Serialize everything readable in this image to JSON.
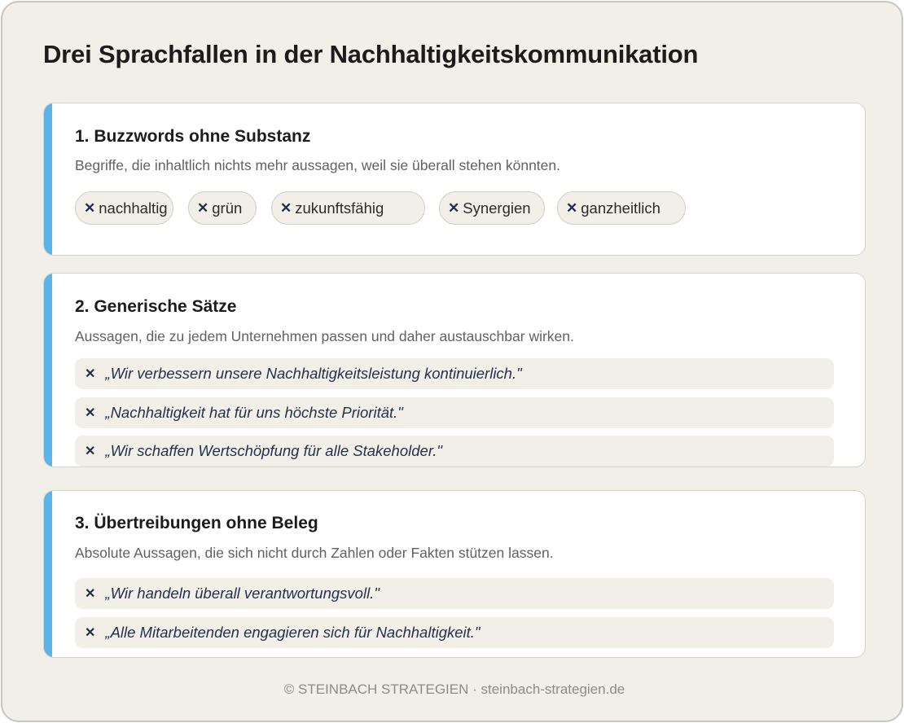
{
  "title": "Drei Sprachfallen in der Nachhaltigkeitskommunikation",
  "cross_symbol": "✕",
  "sections": [
    {
      "heading": "1. Buzzwords ohne Substanz",
      "description": "Begriffe, die inhaltlich nichts mehr aussagen, weil sie überall stehen könnten.",
      "tags": [
        "nachhaltig",
        "grün",
        "zukunftsfähig",
        "Synergien",
        "ganzheitlich"
      ]
    },
    {
      "heading": "2. Generische Sätze",
      "description": "Aussagen, die zu jedem Unternehmen passen und daher austauschbar wirken.",
      "examples": [
        "„Wir verbessern unsere Nachhaltigkeitsleistung kontinuierlich.\"",
        "„Nachhaltigkeit hat für uns höchste Priorität.\"",
        "„Wir schaffen Wertschöpfung für alle Stakeholder.\""
      ]
    },
    {
      "heading": "3. Übertreibungen ohne Beleg",
      "description": "Absolute Aussagen, die sich nicht durch Zahlen oder Fakten stützen lassen.",
      "examples": [
        "„Wir handeln überall verantwortungsvoll.\"",
        "„Alle Mitarbeitenden engagieren sich für Nachhaltigkeit.\""
      ]
    }
  ],
  "footer": "© STEINBACH STRATEGIEN · steinbach-strategien.de",
  "colors": {
    "accent": "#5db3e6",
    "background": "#f2efe9",
    "card": "#ffffff",
    "cross": "#1f2f47"
  }
}
